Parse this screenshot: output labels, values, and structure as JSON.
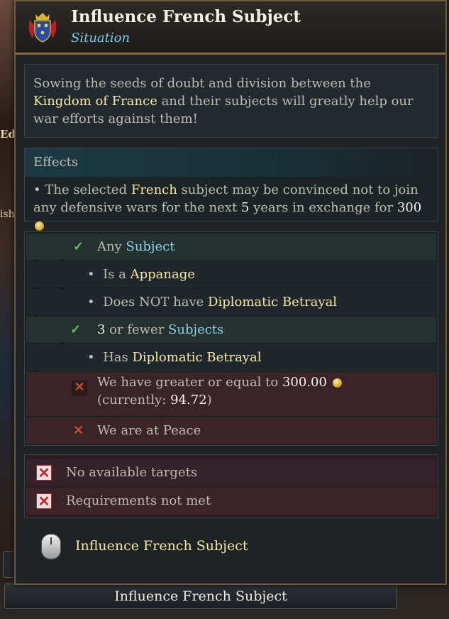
{
  "background": {
    "left_label_1": "Ed",
    "left_label_2": "ish",
    "bottom_button_label": "Influence French Subject"
  },
  "tooltip": {
    "title": "Influence French Subject",
    "subtitle": "Situation",
    "emblem_icon": "french-royal-arms-icon",
    "description": {
      "part1": "Sowing the seeds of doubt and division between the ",
      "highlight": "Kingdom of France",
      "part2": " and their subjects will greatly help our war efforts against them!"
    },
    "effects": {
      "header": "Effects",
      "bullet": "• ",
      "t1": "The selected ",
      "h1": "French",
      "t2": " subject may be convinced not to join any defensive wars for the next ",
      "h2": "5",
      "t3": " years in exchange for ",
      "h3": "300",
      "coin_icon": "gold-coin-icon"
    },
    "requirements": [
      {
        "status": "met",
        "pre": "Any ",
        "hl": "Subject",
        "post": ""
      },
      {
        "status": "bullet",
        "pre": "Is a ",
        "hl": "Appanage",
        "post": ""
      },
      {
        "status": "bullet",
        "pre": "Does NOT have ",
        "hl": "Diplomatic Betrayal",
        "post": ""
      },
      {
        "status": "met",
        "pre": " or fewer ",
        "num": "3",
        "hl": "Subjects",
        "post": ""
      },
      {
        "status": "bullet",
        "pre": "Has ",
        "hl": "Diplomatic Betrayal",
        "post": ""
      },
      {
        "status": "failed",
        "pre": "We have greater or equal to ",
        "num": "300.00",
        "line2_pre": "(currently: ",
        "line2_num": "94.72",
        "line2_post": ")"
      },
      {
        "status": "failed",
        "pre": "We are at Peace"
      }
    ],
    "status": [
      {
        "label": "No available targets",
        "icon": "red-x-icon"
      },
      {
        "label": "Requirements not met",
        "icon": "red-x-icon"
      }
    ],
    "action": {
      "icon": "mouse-left-click-icon",
      "label": "Influence French Subject"
    },
    "colors": {
      "highlight": "#f4e6a6",
      "link_blue": "#8dd1ee",
      "met_green": "#5fbf5f",
      "failed_red": "#c94a3a"
    }
  }
}
